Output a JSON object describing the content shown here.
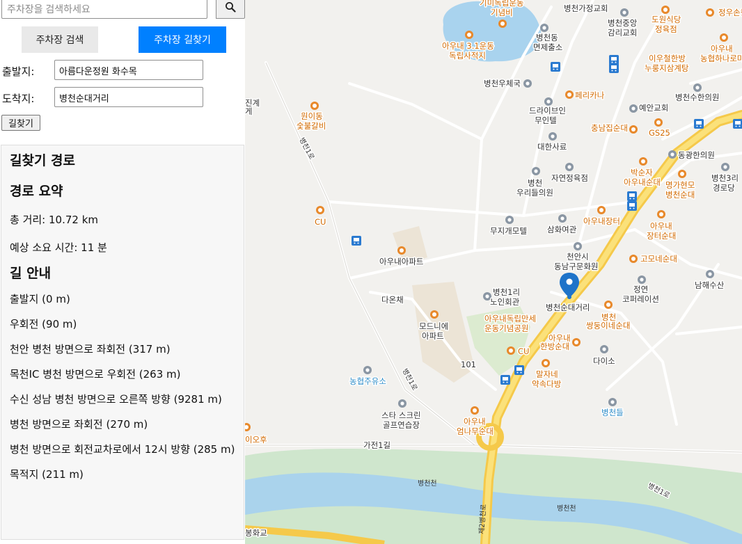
{
  "search": {
    "placeholder": "주차장을 검색하세요",
    "button_icon": "search-icon"
  },
  "tabs": {
    "search_label": "주차장 검색",
    "route_label": "주차장 길찾기",
    "active_color": "#0080ff"
  },
  "route_form": {
    "origin_label": "출발지:",
    "origin_value": "아름다운정원 화수목",
    "destination_label": "도착지:",
    "destination_value": "병천순대거리",
    "go_button": "길찾기"
  },
  "result": {
    "title": "길찾기 경로",
    "summary_heading": "경로 요약",
    "total_distance": "총 거리: 10.72 km",
    "eta": "예상 소요 시간: 11 분",
    "guide_heading": "길 안내",
    "steps": [
      "출발지 (0 m)",
      "우회전 (90 m)",
      "천안 병천 방면으로 좌회전 (317 m)",
      "목천IC 병천 방면으로 우회전 (263 m)",
      "수신 성남 병천 방면으로 오른쪽 방향 (9281 m)",
      "병천 방면으로 좌회전 (270 m)",
      "병천 방면으로 회전교차로에서 12시 방향 (285 m)",
      "목적지 (211 m)"
    ]
  },
  "map": {
    "destination_marker": "병천순대거리",
    "labels": {
      "kimi": "기미독립운동",
      "kimi2": "기념비",
      "bcgj": "병천가정교회",
      "dowon": "도원식당",
      "dowon2": "정육점",
      "jungson": "정우손칼",
      "auna_mem": "아우내 3.1운동",
      "auna_mem2": "독립사적지",
      "bc_church": "병천중앙",
      "bc_church2": "감리교회",
      "bc_office": "병천동",
      "bc_office2": "면제출소",
      "iwoochul": "이우철한방",
      "iwoochul2": "누룽지삼계탕",
      "auna_nh": "아우내",
      "auna_nh2": "농협하나로마",
      "bc_post": "병천우체국",
      "pericana": "페리카나",
      "bc_sh": "병천수한의원",
      "wonidong": "원이동",
      "wonidong2": "숯불갈비",
      "drive": "드라이브인",
      "drive2": "무인텔",
      "yeangan": "예안교회",
      "chungnam": "충남집순대",
      "gs25": "GS25",
      "daehan": "대한사료",
      "donggwang": "동광한의원",
      "nature": "자연정육점",
      "bakseonja": "박순자",
      "bakseonja2": "아우내순대",
      "myeongga": "명가현모",
      "myeongga2": "병천순대",
      "bc3": "병천3리",
      "bc3b": "경로당",
      "bcwoori": "병천",
      "bcwoori2": "우리들의원",
      "cu1": "CU",
      "mujigae": "무지개모텔",
      "samhwa": "삼화여관",
      "aunajang": "아우내장터",
      "aunajangter": "아우내",
      "aunajangter2": "장터순대",
      "aunapt": "아우내아파트",
      "cheonan_dn": "천안시",
      "cheonan_dn2": "동남구문화원",
      "gomone": "고모네순대",
      "nahae": "남해수산",
      "bc1": "병천1리",
      "bc1b": "노인회관",
      "jungyeon": "정연",
      "jungyeon2": "코퍼레이션",
      "daonchae": "다온채",
      "destination": "병천순대거리",
      "modni": "모드니에",
      "modni2": "아파트",
      "park": "아우내독립만세",
      "park2": "운동기념공원",
      "bc_ssang": "병천",
      "bc_ssang2": "쌍둥이네순대",
      "aunahan": "아우내",
      "aunahan2": "한방순대",
      "cu2": "CU",
      "daiso": "다이소",
      "n101": "101",
      "nonghyup_oil": "농협주유소",
      "maljane": "말자네",
      "maljane2": "약속다방",
      "bcdeul": "병천들",
      "star": "스타 스크린",
      "star2": "골프연습장",
      "aunaeom": "아우내",
      "aunaeom2": "엄나무순대",
      "iohu": "이오후",
      "gajeon": "가전1길",
      "bcstream": "병천천",
      "bcstream2": "병천천",
      "bcro": "병천1로",
      "bcro2": "병천1로",
      "bcro3": "병천1로",
      "route21": "제2병천로",
      "bonghwa": "봉화교",
      "left_edge": "진계",
      "left_edge2": "게"
    }
  }
}
